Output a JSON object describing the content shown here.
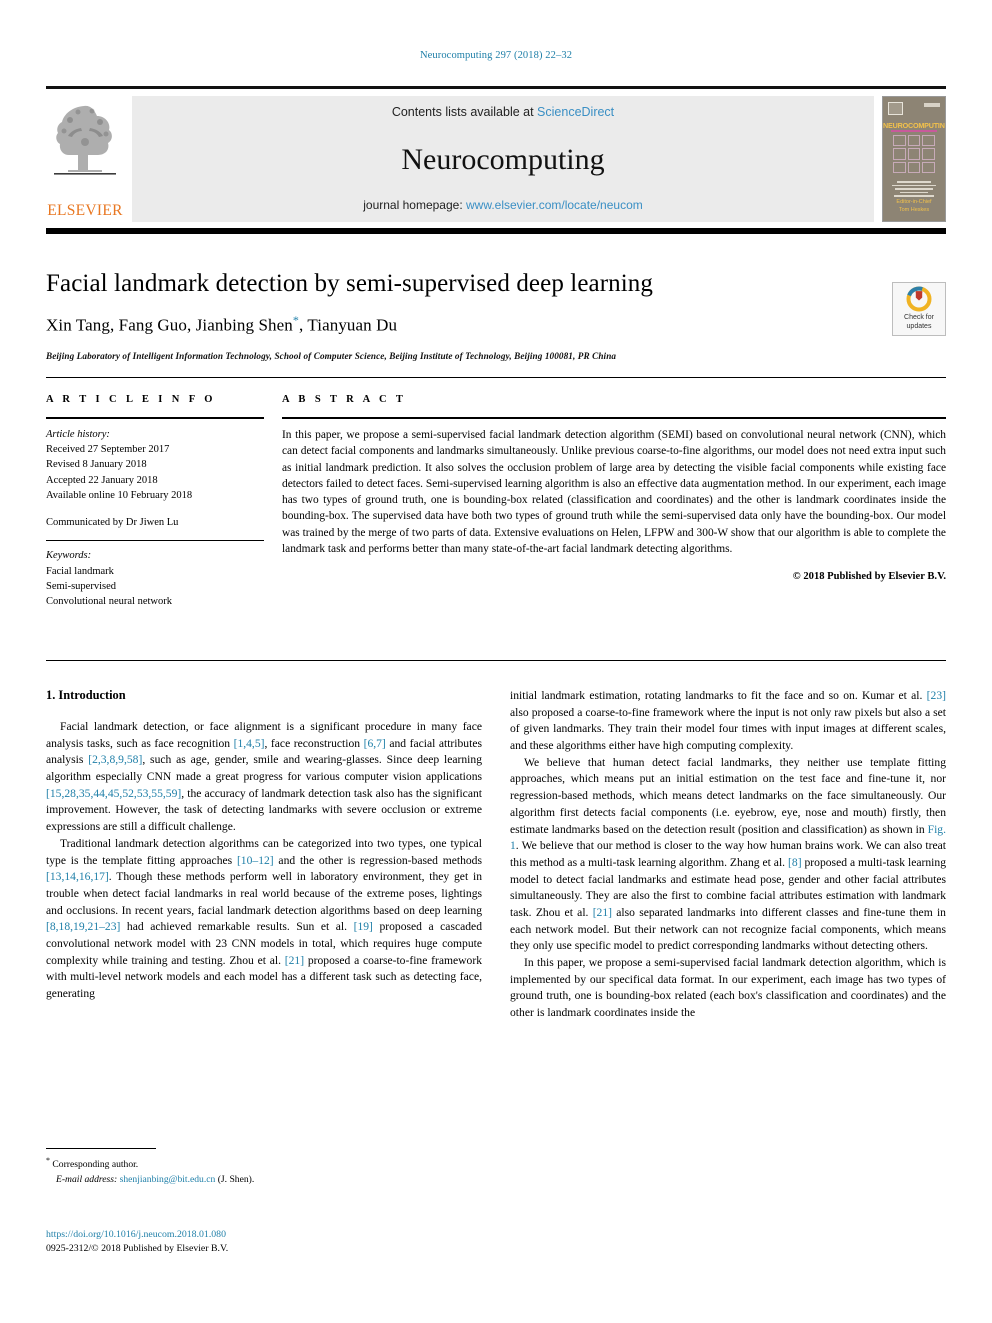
{
  "running_head": "Neurocomputing 297 (2018) 22–32",
  "masthead": {
    "publisher_name": "ELSEVIER",
    "contents_prefix": "Contents lists available at ",
    "sciencedirect_link": "ScienceDirect",
    "journal_title": "Neurocomputing",
    "homepage_prefix": "journal homepage: ",
    "homepage_link": "www.elsevier.com/locate/neucom",
    "cover": {
      "title": "NEUROCOMPUTING",
      "footer_line1": "Editor-in-Chief",
      "footer_line2": "Tom Heskes"
    }
  },
  "article": {
    "title": "Facial landmark detection by semi-supervised deep learning",
    "authors": "Xin Tang, Fang Guo, Jianbing Shen",
    "authors_tail": ", Tianyuan Du",
    "corresponding_marker": "*",
    "affiliation": "Beijing Laboratory of Intelligent Information Technology, School of Computer Science, Beijing Institute of Technology, Beijing 100081, PR China",
    "crossmark_label_line1": "Check for",
    "crossmark_label_line2": "updates"
  },
  "article_info": {
    "heading": "A R T I C L E   I N F O",
    "history_label": "Article history:",
    "history": [
      "Received 27 September 2017",
      "Revised 8 January 2018",
      "Accepted 22 January 2018",
      "Available online 10 February 2018"
    ],
    "communicated_by": "Communicated by Dr Jiwen Lu",
    "keywords_label": "Keywords:",
    "keywords": [
      "Facial landmark",
      "Semi-supervised",
      "Convolutional neural network"
    ]
  },
  "abstract": {
    "heading": "A B S T R A C T",
    "text": "In this paper, we propose a semi-supervised facial landmark detection algorithm (SEMI) based on convolutional neural network (CNN), which can detect facial components and landmarks simultaneously. Unlike previous coarse-to-fine algorithms, our model does not need extra input such as initial landmark prediction. It also solves the occlusion problem of large area by detecting the visible facial components while existing face detectors failed to detect faces. Semi-supervised learning algorithm is also an effective data augmentation method. In our experiment, each image has two types of ground truth, one is bounding-box related (classification and coordinates) and the other is landmark coordinates inside the bounding-box. The supervised data have both two types of ground truth while the semi-supervised data only have the bounding-box. Our model was trained by the merge of two parts of data. Extensive evaluations on Helen, LFPW and 300-W show that our algorithm is able to complete the landmark task and performs better than many state-of-the-art facial landmark detecting algorithms.",
    "copyright": "© 2018 Published by Elsevier B.V."
  },
  "body": {
    "section_title": "1. Introduction",
    "left_paragraphs": [
      {
        "indent": true,
        "parts": [
          {
            "t": "Facial landmark detection, or face alignment is a significant procedure in many face analysis tasks, such as face recognition "
          },
          {
            "t": "[1,4,5]",
            "ref": true
          },
          {
            "t": ", face reconstruction "
          },
          {
            "t": "[6,7]",
            "ref": true
          },
          {
            "t": " and facial attributes analysis "
          },
          {
            "t": "[2,3,8,9,58]",
            "ref": true
          },
          {
            "t": ", such as age, gender, smile and wearing-glasses. Since deep learning algorithm especially CNN made a great progress for various computer vision applications "
          },
          {
            "t": "[15,28,35,44,45,52,53,55,59]",
            "ref": true
          },
          {
            "t": ", the accuracy of landmark detection task also has the significant improvement. However, the task of detecting landmarks with severe occlusion or extreme expressions are still a difficult challenge."
          }
        ]
      },
      {
        "indent": true,
        "parts": [
          {
            "t": "Traditional landmark detection algorithms can be categorized into two types, one typical type is the template fitting approaches "
          },
          {
            "t": "[10–12]",
            "ref": true
          },
          {
            "t": " and the other is regression-based methods "
          },
          {
            "t": "[13,14,16,17]",
            "ref": true
          },
          {
            "t": ". Though these methods perform well in laboratory environment, they get in trouble when detect facial landmarks in real world because of the extreme poses, lightings and occlusions. In recent years, facial landmark detection algorithms based on deep learning "
          },
          {
            "t": "[8,18,19,21–23]",
            "ref": true
          },
          {
            "t": " had achieved remarkable results. Sun et al. "
          },
          {
            "t": "[19]",
            "ref": true
          },
          {
            "t": " proposed a cascaded convolutional network model with 23 CNN models in total, which requires huge compute complexity while training and testing. Zhou et al. "
          },
          {
            "t": "[21]",
            "ref": true
          },
          {
            "t": " proposed a coarse-to-fine framework with multi-level network models and each model has a different task such as detecting face, generating"
          }
        ]
      }
    ],
    "right_paragraphs": [
      {
        "indent": false,
        "parts": [
          {
            "t": "initial landmark estimation, rotating landmarks to fit the face and so on. Kumar et al. "
          },
          {
            "t": "[23]",
            "ref": true
          },
          {
            "t": " also proposed a coarse-to-fine framework where the input is not only raw pixels but also a set of given landmarks. They train their model four times with input images at different scales, and these algorithms either have high computing complexity."
          }
        ]
      },
      {
        "indent": true,
        "parts": [
          {
            "t": "We believe that human detect facial landmarks, they neither use template fitting approaches, which means put an initial estimation on the test face and fine-tune it, nor regression-based methods, which means detect landmarks on the face simultaneously. Our algorithm first detects facial components (i.e. eyebrow, eye, nose and mouth) firstly, then estimate landmarks based on the detection result (position and classification) as shown in "
          },
          {
            "t": "Fig. 1",
            "ref": true
          },
          {
            "t": ". We believe that our method is closer to the way how human brains work. We can also treat this method as a multi-task learning algorithm. Zhang et al. "
          },
          {
            "t": "[8]",
            "ref": true
          },
          {
            "t": " proposed a multi-task learning model to detect facial landmarks and estimate head pose, gender and other facial attributes simultaneously. They are also the first to combine facial attributes estimation with landmark task. Zhou et al. "
          },
          {
            "t": "[21]",
            "ref": true
          },
          {
            "t": " also separated landmarks into different classes and fine-tune them in each network model. But their network can not recognize facial components, which means they only use specific model to predict corresponding landmarks without detecting others."
          }
        ]
      },
      {
        "indent": true,
        "parts": [
          {
            "t": "In this paper, we propose a semi-supervised facial landmark detection algorithm, which is implemented by our specifical data format. In our experiment, each image has two types of ground truth, one is bounding-box related (each box's classification and coordinates) and the other is landmark coordinates inside the"
          }
        ]
      }
    ]
  },
  "footnote": {
    "corresponding_marker": "*",
    "corresponding_text": "Corresponding author.",
    "email_label": "E-mail address:",
    "email": "shenjianbing@bit.edu.cn",
    "email_owner": "(J. Shen)."
  },
  "footer": {
    "doi": "https://doi.org/10.1016/j.neucom.2018.01.080",
    "issn_line": "0925-2312/© 2018 Published by Elsevier B.V."
  },
  "colors": {
    "link_blue": "#1f7fa8",
    "elsevier_orange": "#e87722",
    "band_gray": "#ebebeb"
  }
}
